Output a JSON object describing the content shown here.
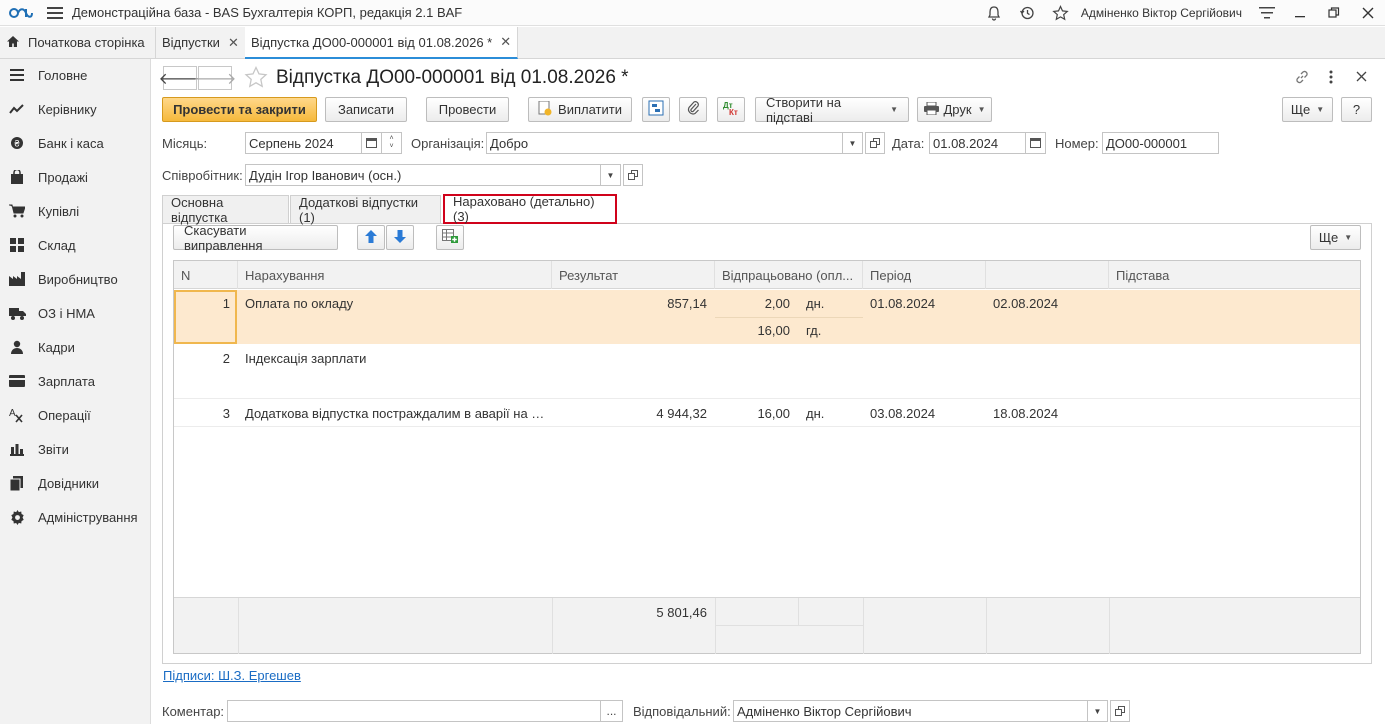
{
  "app": {
    "title": "Демонстраційна база - BAS Бухгалтерія КОРП, редакція 2.1 BAF",
    "user": "Адміненко Віктор Сергійович"
  },
  "tabs": {
    "home": "Початкова сторінка",
    "items": [
      {
        "label": "Відпустки"
      },
      {
        "label": "Відпустка ДО00-000001 від 01.08.2026 *"
      }
    ]
  },
  "sidebar": {
    "items": [
      {
        "label": "Головне",
        "icon": "menu-lines-icon"
      },
      {
        "label": "Керівнику",
        "icon": "trend-icon"
      },
      {
        "label": "Банк і каса",
        "icon": "coin-icon"
      },
      {
        "label": "Продажі",
        "icon": "bag-icon"
      },
      {
        "label": "Купівлі",
        "icon": "cart-icon"
      },
      {
        "label": "Склад",
        "icon": "warehouse-icon"
      },
      {
        "label": "Виробництво",
        "icon": "factory-icon"
      },
      {
        "label": "ОЗ і НМА",
        "icon": "truck-icon"
      },
      {
        "label": "Кадри",
        "icon": "person-icon"
      },
      {
        "label": "Зарплата",
        "icon": "card-icon"
      },
      {
        "label": "Операції",
        "icon": "operations-icon"
      },
      {
        "label": "Звіти",
        "icon": "bar-chart-icon"
      },
      {
        "label": "Довідники",
        "icon": "books-icon"
      },
      {
        "label": "Адміністрування",
        "icon": "gear-icon"
      }
    ]
  },
  "document": {
    "title": "Відпустка ДО00-000001 від 01.08.2026 *"
  },
  "toolbar": {
    "post_close": "Провести та закрити",
    "save": "Записати",
    "post": "Провести",
    "pay": "Виплатити",
    "create_based": "Створити на підставі",
    "print": "Друк",
    "more": "Ще",
    "help": "?"
  },
  "form": {
    "month_label": "Місяць:",
    "month_value": "Серпень 2024",
    "org_label": "Організація:",
    "org_value": "Добро",
    "date_label": "Дата:",
    "date_value": "01.08.2024",
    "number_label": "Номер:",
    "number_value": "ДО00-000001",
    "employee_label": "Співробітник:",
    "employee_value": "Дудін Ігор Іванович (осн.)"
  },
  "form_tabs": [
    {
      "label": "Основна відпустка"
    },
    {
      "label": "Додаткові відпустки (1)"
    },
    {
      "label": "Нараховано (детально) (3)"
    }
  ],
  "table_toolbar": {
    "cancel_fix": "Скасувати виправлення",
    "more": "Ще"
  },
  "table": {
    "headers": [
      "N",
      "Нарахування",
      "Результат",
      "Відпрацьовано (опл...",
      "Період",
      "",
      "Підстава"
    ],
    "rows": [
      {
        "n": "1",
        "accrual": "Оплата по окладу",
        "result": "857,14",
        "worked1": "2,00",
        "unit1": "дн.",
        "worked2": "16,00",
        "unit2": "гд.",
        "from": "01.08.2024",
        "to": "02.08.2024",
        "basis": ""
      },
      {
        "n": "2",
        "accrual": "Індексація зарплати",
        "result": "",
        "worked1": "",
        "unit1": "",
        "worked2": "",
        "unit2": "",
        "from": "",
        "to": "",
        "basis": ""
      },
      {
        "n": "3",
        "accrual": "Додаткова відпустка постраждалим в аварії на Ч...",
        "result": "4 944,32",
        "worked1": "16,00",
        "unit1": "дн.",
        "worked2": "",
        "unit2": "",
        "from": "03.08.2024",
        "to": "18.08.2024",
        "basis": ""
      }
    ],
    "total_result": "5 801,46"
  },
  "footer": {
    "signatures_link": "Підписи: Ш.З. Ергешев",
    "comment_label": "Коментар:",
    "comment_value": "",
    "responsible_label": "Відповідальний:",
    "responsible_value": "Адміненко Віктор Сергійович"
  }
}
